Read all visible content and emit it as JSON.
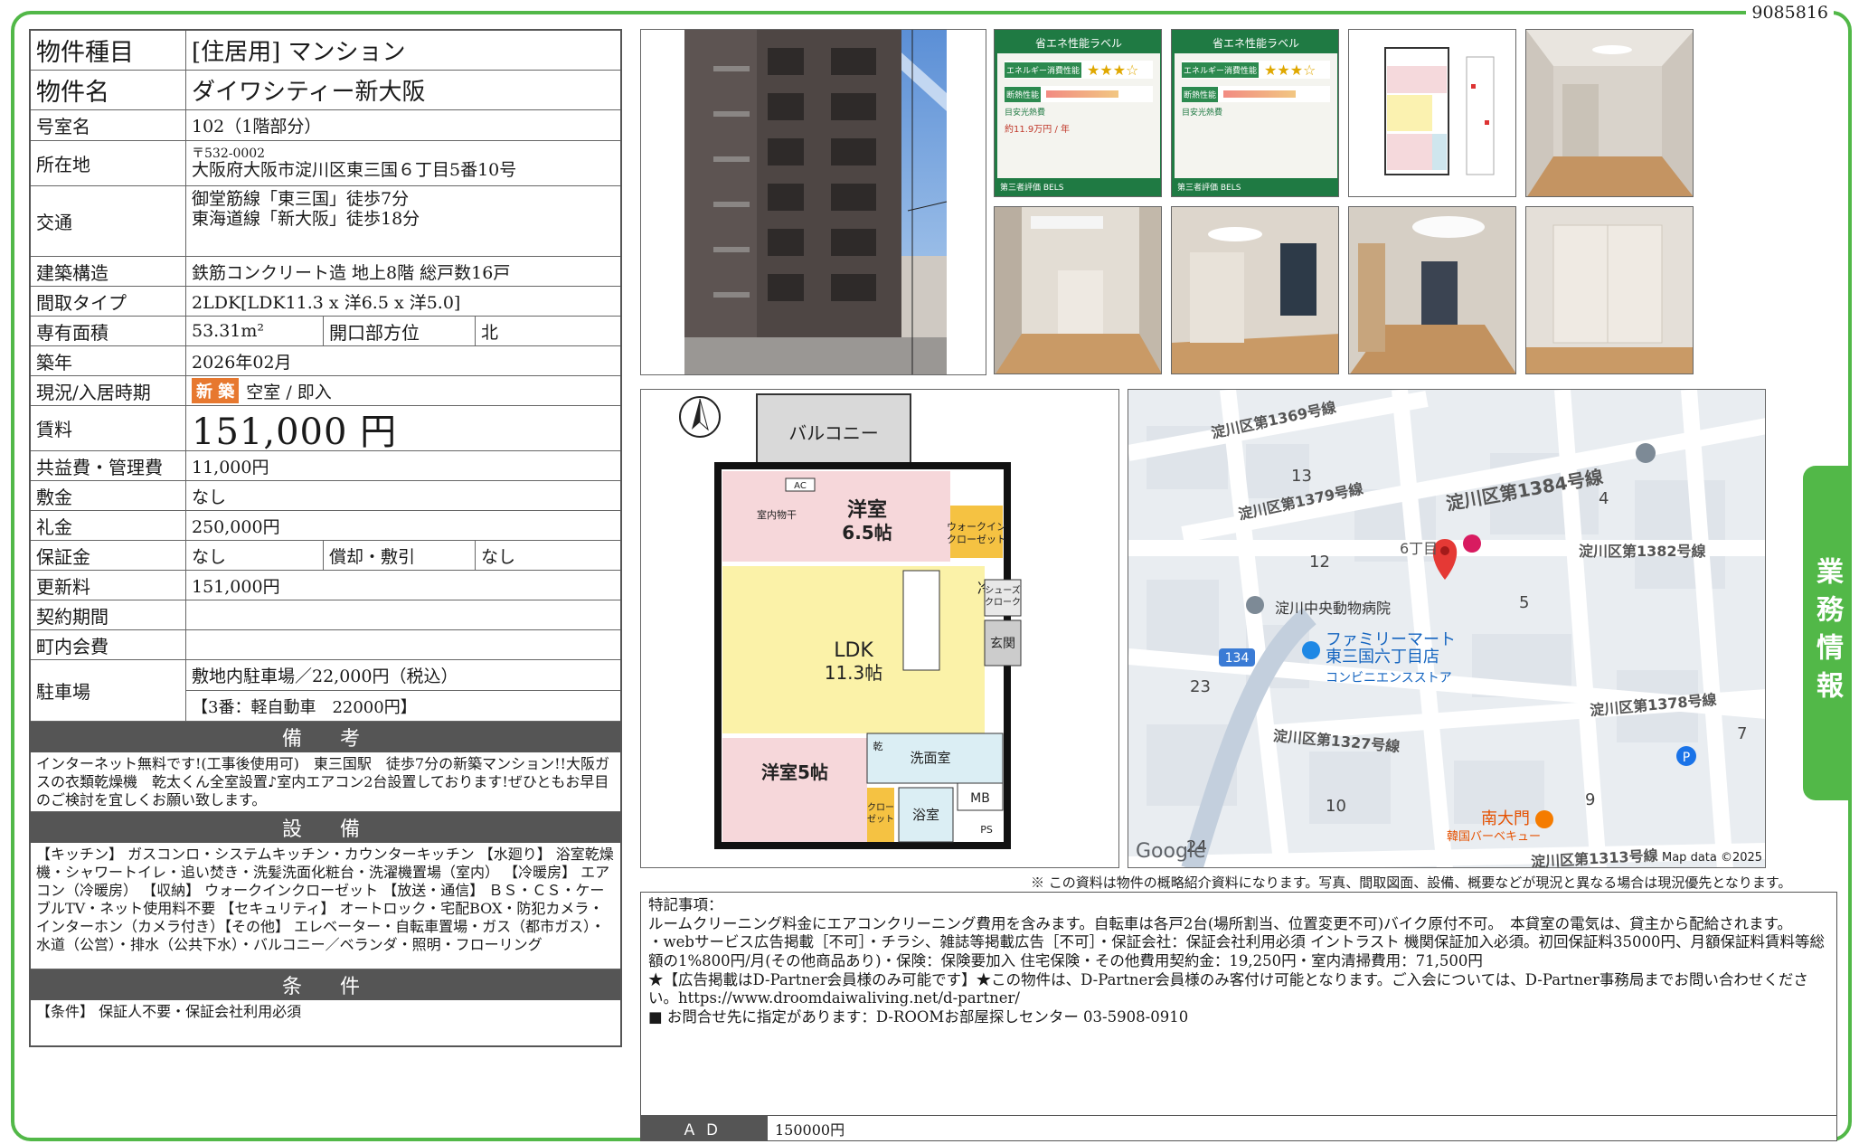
{
  "property_id": "9085816",
  "table": {
    "type_label": "物件種目",
    "type_value": "[住居用] マンション",
    "name_label": "物件名",
    "name_value": "ダイワシティー新大阪",
    "room_label": "号室名",
    "room_value": "102（1階部分）",
    "address_label": "所在地",
    "address_zip": "〒532-0002",
    "address_value": "大阪府大阪市淀川区東三国６丁目5番10号",
    "access_label": "交通",
    "access_line1": "御堂筋線「東三国」徒歩7分",
    "access_line2": "東海道線「新大阪」徒歩18分",
    "structure_label": "建築構造",
    "structure_value": "鉄筋コンクリート造 地上8階 総戸数16戸",
    "layout_label": "間取タイプ",
    "layout_value": "2LDK[LDK11.3 x 洋6.5 x 洋5.0]",
    "area_label": "専有面積",
    "area_value": "53.31m²",
    "direction_label": "開口部方位",
    "direction_value": "北",
    "built_label": "築年",
    "built_value": "2026年02月",
    "status_label": "現況/入居時期",
    "status_badge": "新 築",
    "status_value": "空室 / 即入",
    "rent_label": "賃料",
    "rent_value": "151,000 円",
    "fee_label": "共益費・管理費",
    "fee_value": "11,000円",
    "deposit_label": "敷金",
    "deposit_value": "なし",
    "key_money_label": "礼金",
    "key_money_value": "250,000円",
    "guarantee_label": "保証金",
    "guarantee_value": "なし",
    "amort_label": "償却・敷引",
    "amort_value": "なし",
    "renewal_label": "更新料",
    "renewal_value": "151,000円",
    "contract_label": "契約期間",
    "contract_value": "",
    "town_label": "町内会費",
    "town_value": "",
    "parking_label": "駐車場",
    "parking_line1": "敷地内駐車場／22,000円（税込）",
    "parking_line2": "【3番：軽自動車　22000円】"
  },
  "remarks": {
    "title": "備　考",
    "text": "インターネット無料です!(工事後使用可)　東三国駅　徒歩7分の新築マンション!!大阪ガスの衣類乾燥機　乾太くん全室設置♪室内エアコン2台設置しております!ぜひともお早目のご検討を宜しくお願い致します。"
  },
  "equipment": {
    "title": "設　備",
    "text": "【キッチン】 ガスコンロ・システムキッチン・カウンターキッチン 【水廻り】 浴室乾燥機・シャワートイレ・追い焚き・洗髪洗面化粧台・洗濯機置場（室内） 【冷暖房】 エアコン（冷暖房） 【収納】 ウォークインクローゼット 【放送・通信】 ＢＳ・ＣＳ・ケーブルTV・ネット使用料不要 【セキュリティ】 オートロック・宅配BOX・防犯カメラ・インターホン（カメラ付き）【その他】 エレベーター・自転車置場・ガス（都市ガス）・水道（公営）・排水（公共下水）・バルコニー／ベランダ・照明・フローリング"
  },
  "conditions": {
    "title": "条　件",
    "text": "【条件】 保証人不要・保証会社利用必須"
  },
  "label_cards": {
    "header": "省エネ性能ラベル",
    "energy_label": "エネルギー消費性能",
    "insulation_label": "断熱性能",
    "cost_label": "目安光熱費",
    "cost_value": "約11.9万円 / 年",
    "footer": "第三者評価 BELS"
  },
  "floor_plan": {
    "balcony": "バルコニー",
    "room1": "洋室\n6.5帖",
    "laundry": "室内物干",
    "ac": "AC",
    "wic": "ウォークイン\nクローゼット",
    "ldk": "LDK\n11.3帖",
    "shoes": "シューズ\nクローク",
    "entrance": "玄関",
    "fridge": "冷",
    "wash": "洗面室",
    "dryer": "乾",
    "room2": "洋室5帖",
    "closet": "クロー\nゼット",
    "bath": "浴室",
    "mb": "MB",
    "ps": "PS"
  },
  "map": {
    "roads": [
      "淀川区第1369号線",
      "淀川区第1379号線",
      "淀川区第1384号線",
      "淀川区第1382号線",
      "淀川区第1378号線",
      "淀川区第1327号線",
      "淀川区第1313号線"
    ],
    "route": "134",
    "place_hospital": "淀川中央動物病院",
    "place_store": "ファミリーマート\n東三国六丁目店",
    "place_store_sub": "コンビニエンスストア",
    "place_bbq": "南大門",
    "place_bbq_sub": "韓国バーベキュー",
    "area_6": "6丁目",
    "numbers": [
      "13",
      "4",
      "12",
      "5",
      "23",
      "7",
      "10",
      "9",
      "24"
    ],
    "google": "Google",
    "attribution": "Map data ©2025"
  },
  "disclaimer": "※ この資料は物件の概略紹介資料になります。写真、間取図面、設備、概要などが現況と異なる場合は現況優先となります。",
  "notes": {
    "text": "特記事項：\nルームクリーニング料金にエアコンクリーニング費用を含みます。自転車は各戸2台(場所割当、位置変更不可)バイク原付不可。　本貸室の電気は、貸主から配給されます。\n・webサービス広告掲載［不可］・チラシ、雑誌等掲載広告［不可］・保証会社：保証会社利用必須 イントラスト 機関保証加入必須。初回保証料35000円、月額保証料賃料等総額の1%800円/月(その他商品あり)・保険：保険要加入 住宅保険・その他費用契約金：19,250円・室内清掃費用：71,500円\n★【広告掲載はD-Partner会員様のみ可能です】★この物件は、D-Partner会員様のみ客付け可能となります。ご入会については、D-Partner事務局までお問い合わせください。https://www.droomdaiwaliving.net/d-partner/\n■ お問合せ先に指定があります：D-ROOMお部屋探しセンター 03-5908-0910",
    "ad_label": "ＡＤ",
    "ad_value": "150000円"
  },
  "side_tab": "業務情報"
}
